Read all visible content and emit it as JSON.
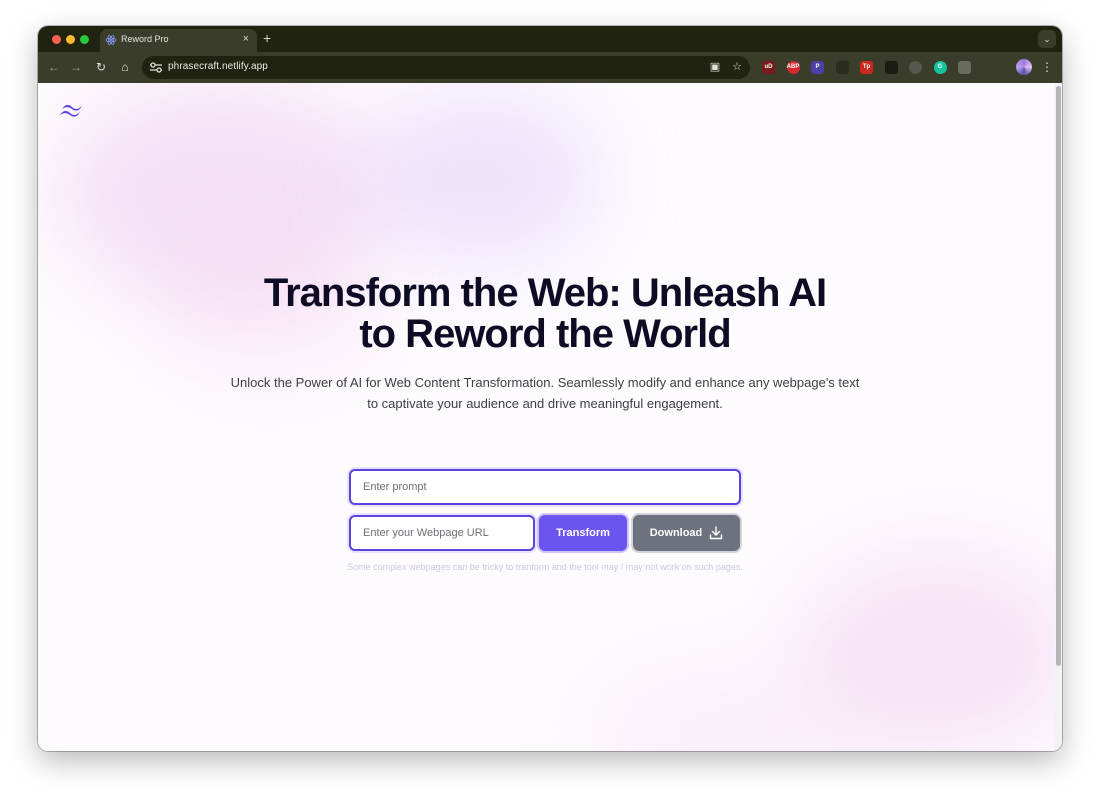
{
  "browser": {
    "tab_title": "Reword Pro",
    "tab_close": "×",
    "new_tab": "+",
    "url": "phrasecraft.netlify.app",
    "extensions": [
      {
        "icon": "ud-icon",
        "label": "uD",
        "color": "#7a1a1a"
      },
      {
        "icon": "abp-icon",
        "label": "ABP",
        "color": "#d4282f"
      },
      {
        "icon": "p-extension-icon",
        "label": "P",
        "color": "#4b3fa8"
      },
      {
        "icon": "window-extension-icon",
        "label": "",
        "color": "#2a2c1e"
      },
      {
        "icon": "tp-icon",
        "label": "Tp",
        "color": "#c8281e"
      },
      {
        "icon": "dark-extension-icon",
        "label": "",
        "color": "#1a1c12"
      },
      {
        "icon": "gear-extension-icon",
        "label": "",
        "color": "#55584a"
      },
      {
        "icon": "grammarly-icon",
        "label": "G",
        "color": "#15c39a"
      },
      {
        "icon": "box-extension-icon",
        "label": "",
        "color": "#6a6c5e"
      },
      {
        "icon": "puzzle-icon",
        "label": "",
        "color": "#3a3d2a"
      }
    ]
  },
  "hero": {
    "title_line1": "Transform the Web: Unleash AI",
    "title_line2": "to Reword the World",
    "subtitle": "Unlock the Power of AI for Web Content Transformation. Seamlessly modify and enhance any webpage's text to captivate your audience and drive meaningful engagement."
  },
  "form": {
    "prompt_placeholder": "Enter prompt",
    "url_placeholder": "Enter your Webpage URL",
    "transform_label": "Transform",
    "download_label": "Download",
    "note": "Some complex webpages can be tricky to tranform and the tool may / may not work on such pages."
  },
  "colors": {
    "accent": "#5b43e0",
    "transform_button": "#6b55ee",
    "download_button": "#6e717e",
    "title": "#0e0c24"
  }
}
